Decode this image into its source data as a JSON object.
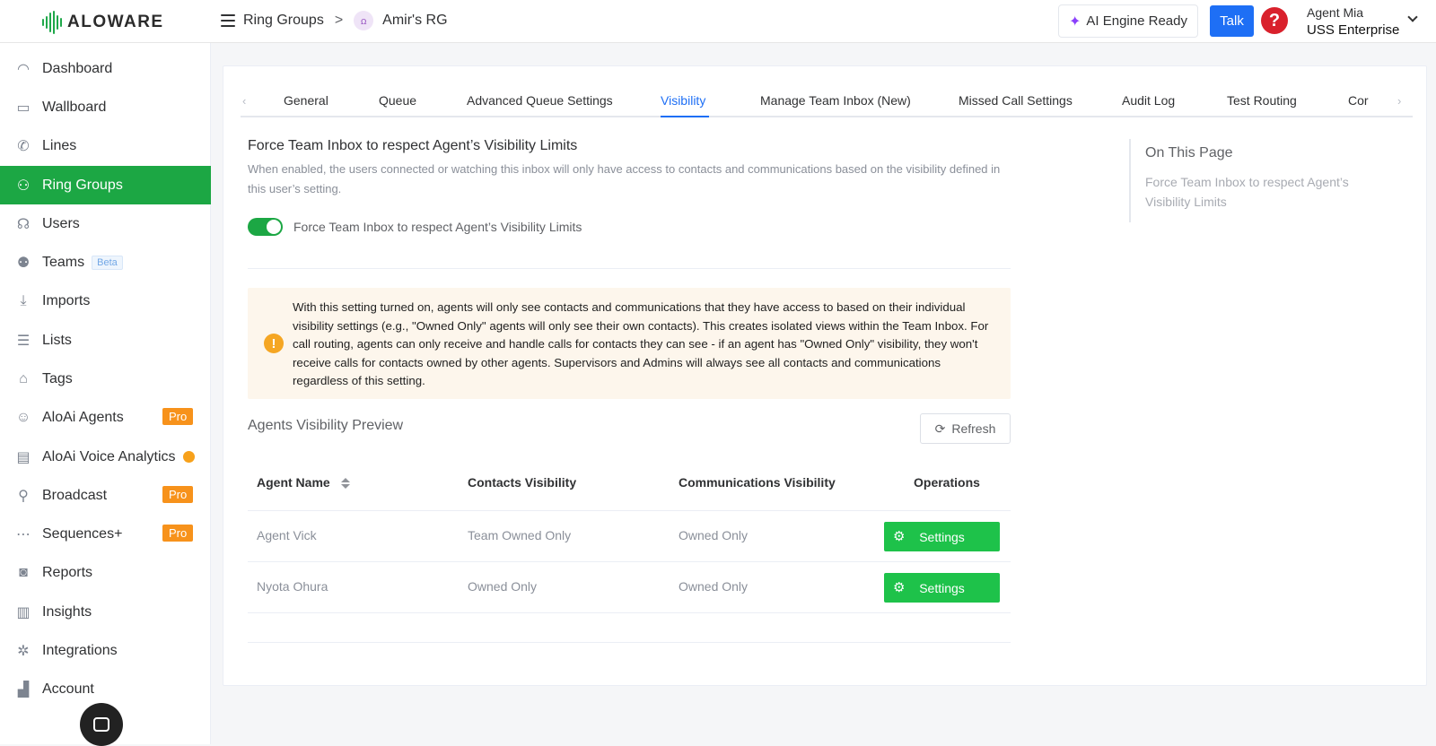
{
  "brand": {
    "name": "ALOWARE",
    "accent": "#1ca744"
  },
  "header": {
    "breadcrumb_root": "Ring Groups",
    "breadcrumb_sep": ">",
    "breadcrumb_current": "Amir's RG",
    "ai_status": "AI Engine Ready",
    "talk_label": "Talk",
    "help_glyph": "?",
    "agent_name": "Agent Mia",
    "agent_org": "USS Enterprise"
  },
  "sidebar": {
    "items": [
      {
        "label": "Dashboard",
        "icon": "dashboard-icon"
      },
      {
        "label": "Wallboard",
        "icon": "wallboard-icon"
      },
      {
        "label": "Lines",
        "icon": "phone-icon"
      },
      {
        "label": "Ring Groups",
        "icon": "ring-groups-icon",
        "active": true
      },
      {
        "label": "Users",
        "icon": "headset-icon"
      },
      {
        "label": "Teams",
        "icon": "team-icon",
        "badge": "Beta"
      },
      {
        "label": "Imports",
        "icon": "import-icon"
      },
      {
        "label": "Lists",
        "icon": "list-icon"
      },
      {
        "label": "Tags",
        "icon": "tag-icon"
      },
      {
        "label": "AloAi Agents",
        "icon": "robot-icon",
        "badge": "Pro"
      },
      {
        "label": "AloAi Voice Analytics",
        "icon": "analytics-icon"
      },
      {
        "label": "Broadcast",
        "icon": "broadcast-icon",
        "badge": "Pro"
      },
      {
        "label": "Sequences+",
        "icon": "sequence-icon",
        "badge": "Pro"
      },
      {
        "label": "Reports",
        "icon": "report-icon"
      },
      {
        "label": "Insights",
        "icon": "insights-icon"
      },
      {
        "label": "Integrations",
        "icon": "integrations-icon"
      },
      {
        "label": "Account",
        "icon": "account-icon"
      }
    ]
  },
  "tabs": [
    "General",
    "Queue",
    "Advanced Queue Settings",
    "Visibility",
    "Manage Team Inbox (New)",
    "Missed Call Settings",
    "Audit Log",
    "Test Routing",
    "Cor"
  ],
  "active_tab": "Visibility",
  "visibility": {
    "title": "Force Team Inbox to respect Agent’s Visibility Limits",
    "description": "When enabled, the users connected or watching this inbox will only have access to contacts and communications based on the visibility defined in this user’s setting.",
    "toggle_label": "Force Team Inbox to respect Agent’s Visibility Limits",
    "toggle_on": true,
    "warning": "With this setting turned on, agents will only see contacts and communications that they have access to based on their individual visibility settings (e.g., \"Owned Only\" agents will only see their own contacts). This creates isolated views within the Team Inbox. For call routing, agents can only receive and handle calls for contacts they can see - if an agent has \"Owned Only\" visibility, they won't receive calls for contacts owned by other agents. Supervisors and Admins will always see all contacts and communications regardless of this setting.",
    "warning_icon": "!"
  },
  "preview": {
    "title": "Agents Visibility Preview",
    "refresh_label": "Refresh",
    "columns": [
      "Agent Name",
      "Contacts Visibility",
      "Communications Visibility",
      "Operations"
    ],
    "rows": [
      {
        "agent": "Agent Vick",
        "contacts": "Team Owned Only",
        "communications": "Owned Only",
        "action": "Settings"
      },
      {
        "agent": "Nyota Ohura",
        "contacts": "Owned Only",
        "communications": "Owned Only",
        "action": "Settings"
      }
    ]
  },
  "on_this_page": {
    "title": "On This Page",
    "link": "Force Team Inbox to respect Agent’s Visibility Limits"
  }
}
